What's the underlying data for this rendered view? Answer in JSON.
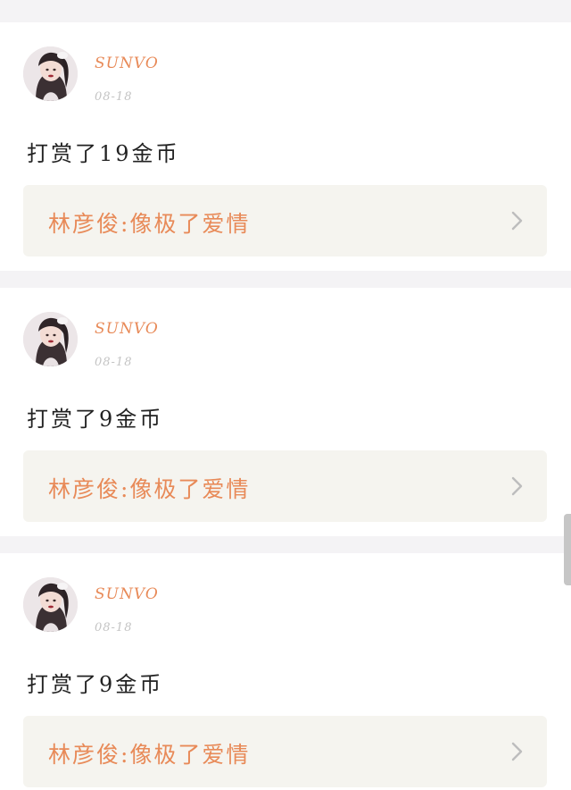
{
  "colors": {
    "background": "#f4f3f5",
    "card": "#ffffff",
    "accent": "#e88a58",
    "muted": "#c4c4c4",
    "link_box": "#f5f4ef",
    "text": "#222222"
  },
  "feed": {
    "items": [
      {
        "username": "SUNVO",
        "date": "08-18",
        "content": "打赏了19金币",
        "link_text": "林彦俊:像极了爱情",
        "avatar_icon": "avatar-portrait-icon",
        "chevron_icon": "chevron-right-icon"
      },
      {
        "username": "SUNVO",
        "date": "08-18",
        "content": "打赏了9金币",
        "link_text": "林彦俊:像极了爱情",
        "avatar_icon": "avatar-portrait-icon",
        "chevron_icon": "chevron-right-icon"
      },
      {
        "username": "SUNVO",
        "date": "08-18",
        "content": "打赏了9金币",
        "link_text": "林彦俊:像极了爱情",
        "avatar_icon": "avatar-portrait-icon",
        "chevron_icon": "chevron-right-icon"
      }
    ]
  }
}
